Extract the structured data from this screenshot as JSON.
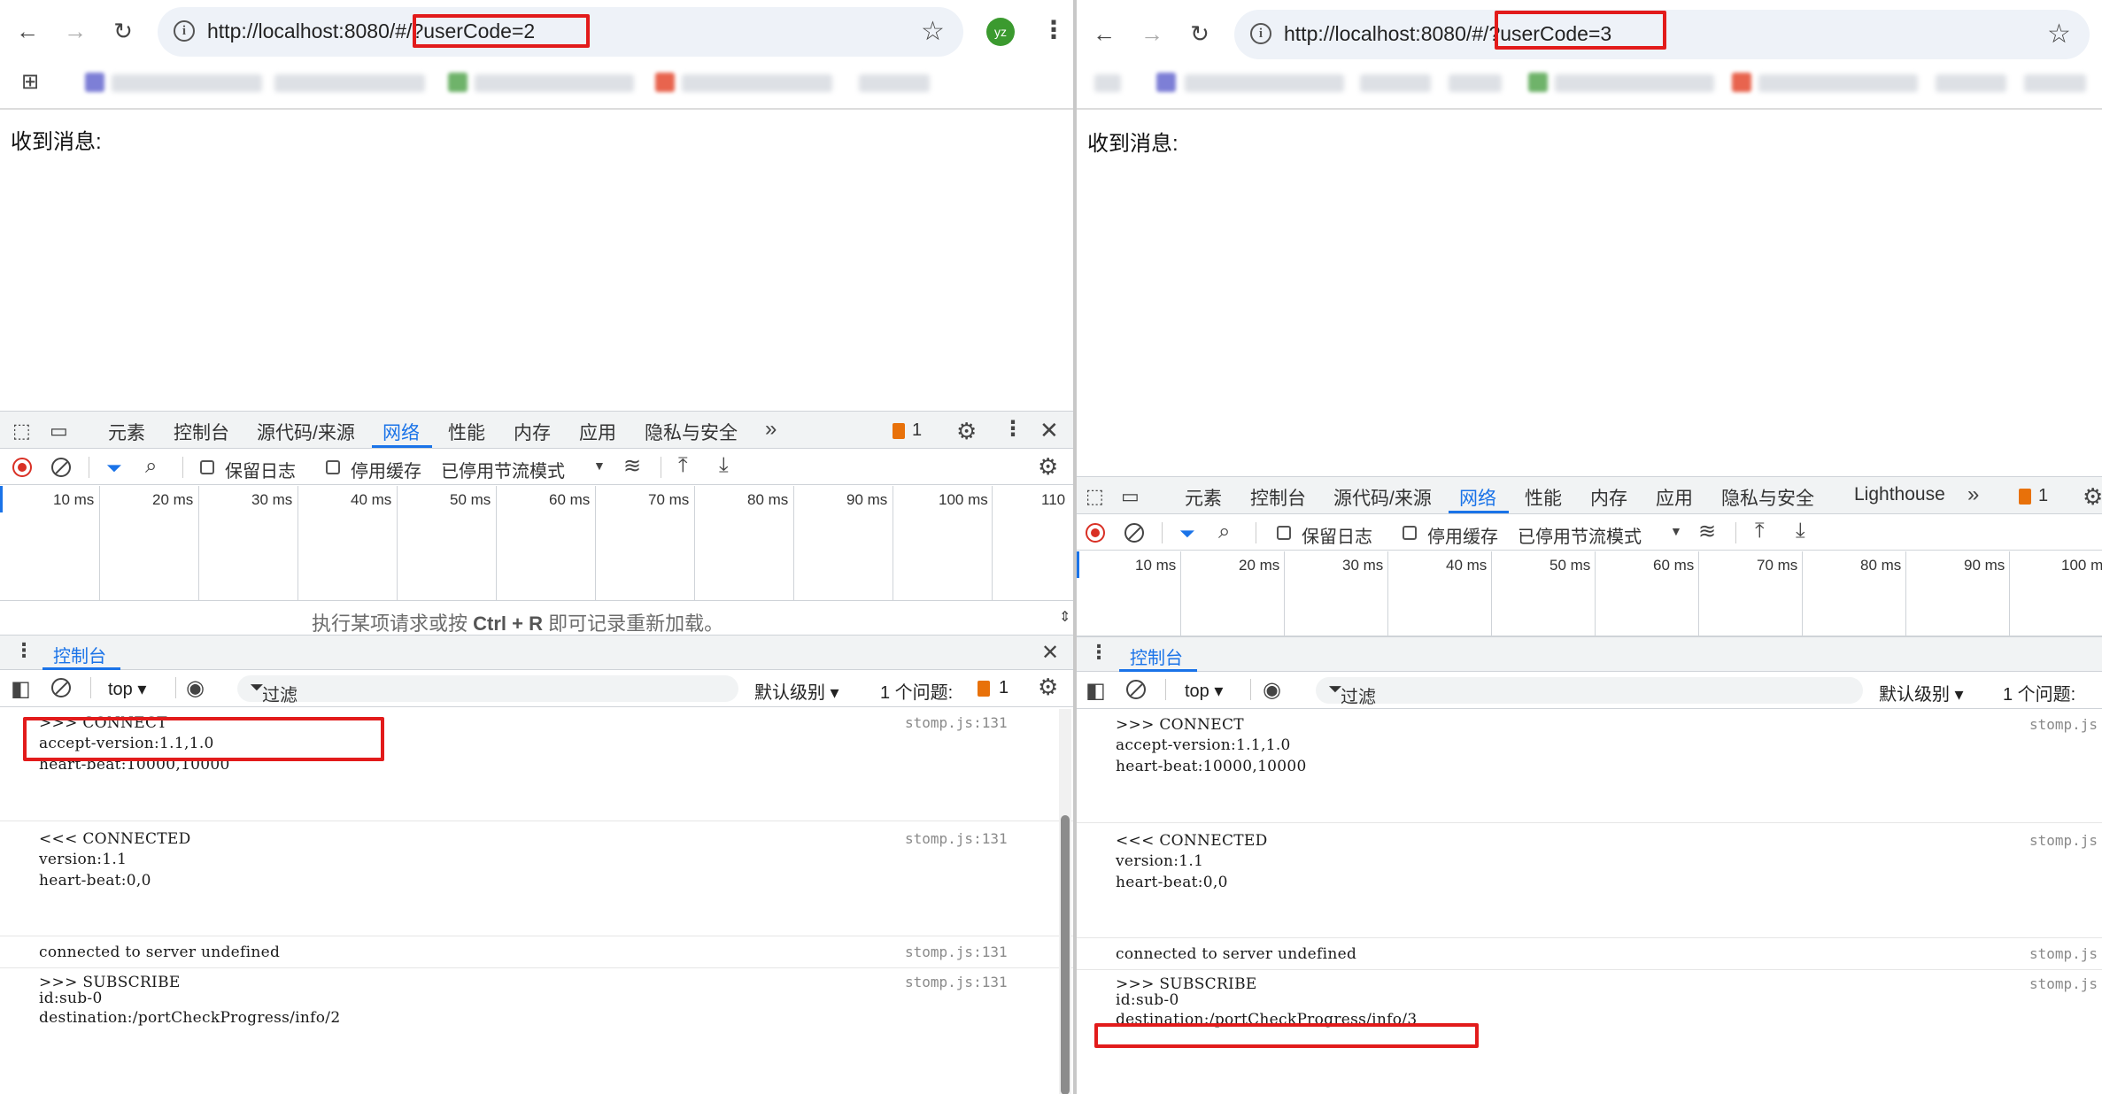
{
  "left": {
    "url_base": "http://localhost:8080/#/",
    "url_query": "?userCode=2",
    "avatar": "yz",
    "page_message": "收到消息:",
    "devtools": {
      "tabs": [
        "元素",
        "控制台",
        "源代码/来源",
        "网络",
        "性能",
        "内存",
        "应用",
        "隐私与安全"
      ],
      "active_tab": "网络",
      "issues": "1",
      "network": {
        "preserve_log": "保留日志",
        "disable_cache": "停用缓存",
        "throttling": "已停用节流模式"
      },
      "timeline_ticks": [
        "10 ms",
        "20 ms",
        "30 ms",
        "40 ms",
        "50 ms",
        "60 ms",
        "70 ms",
        "80 ms",
        "90 ms",
        "100 ms",
        "110"
      ],
      "hint_pre": "执行某项请求或按 ",
      "hint_key": "Ctrl + R",
      "hint_post": " 即可记录重新加载。",
      "drawer_tab": "控制台",
      "console": {
        "context": "top",
        "filter": "过滤",
        "level": "默认级别",
        "issues_label": "1 个问题:",
        "issues_count": "1"
      },
      "log": [
        {
          "lines": [
            ">>> CONNECT",
            "accept-version:1.1,1.0",
            "heart-beat:10000,10000"
          ],
          "source": "stomp.js:131"
        },
        {
          "lines": [
            "<<< CONNECTED",
            "version:1.1",
            "heart-beat:0,0"
          ],
          "source": "stomp.js:131"
        },
        {
          "lines": [
            "connected to server undefined"
          ],
          "source": "stomp.js:131"
        },
        {
          "lines": [
            ">>> SUBSCRIBE",
            "id:sub-0",
            "destination:/portCheckProgress/info/2"
          ],
          "source": "stomp.js:131"
        }
      ]
    }
  },
  "right": {
    "url_base": "http://localhost:8080/#/",
    "url_query": "?userCode=3",
    "page_message": "收到消息:",
    "devtools": {
      "tabs": [
        "元素",
        "控制台",
        "源代码/来源",
        "网络",
        "性能",
        "内存",
        "应用",
        "隐私与安全",
        "Lighthouse"
      ],
      "active_tab": "网络",
      "issues": "1",
      "network": {
        "preserve_log": "保留日志",
        "disable_cache": "停用缓存",
        "throttling": "已停用节流模式"
      },
      "timeline_ticks": [
        "10 ms",
        "20 ms",
        "30 ms",
        "40 ms",
        "50 ms",
        "60 ms",
        "70 ms",
        "80 ms",
        "90 ms",
        "100 m"
      ],
      "drawer_tab": "控制台",
      "console": {
        "context": "top",
        "filter": "过滤",
        "level": "默认级别",
        "issues_label": "1 个问题:"
      },
      "log": [
        {
          "lines": [
            ">>> CONNECT",
            "accept-version:1.1,1.0",
            "heart-beat:10000,10000"
          ],
          "source": "stomp.js"
        },
        {
          "lines": [
            "<<< CONNECTED",
            "version:1.1",
            "heart-beat:0,0"
          ],
          "source": "stomp.js"
        },
        {
          "lines": [
            "connected to server undefined"
          ],
          "source": "stomp.js"
        },
        {
          "lines": [
            ">>> SUBSCRIBE",
            "id:sub-0",
            "destination:/portCheckProgress/info/3"
          ],
          "source": "stomp.js"
        }
      ]
    }
  }
}
